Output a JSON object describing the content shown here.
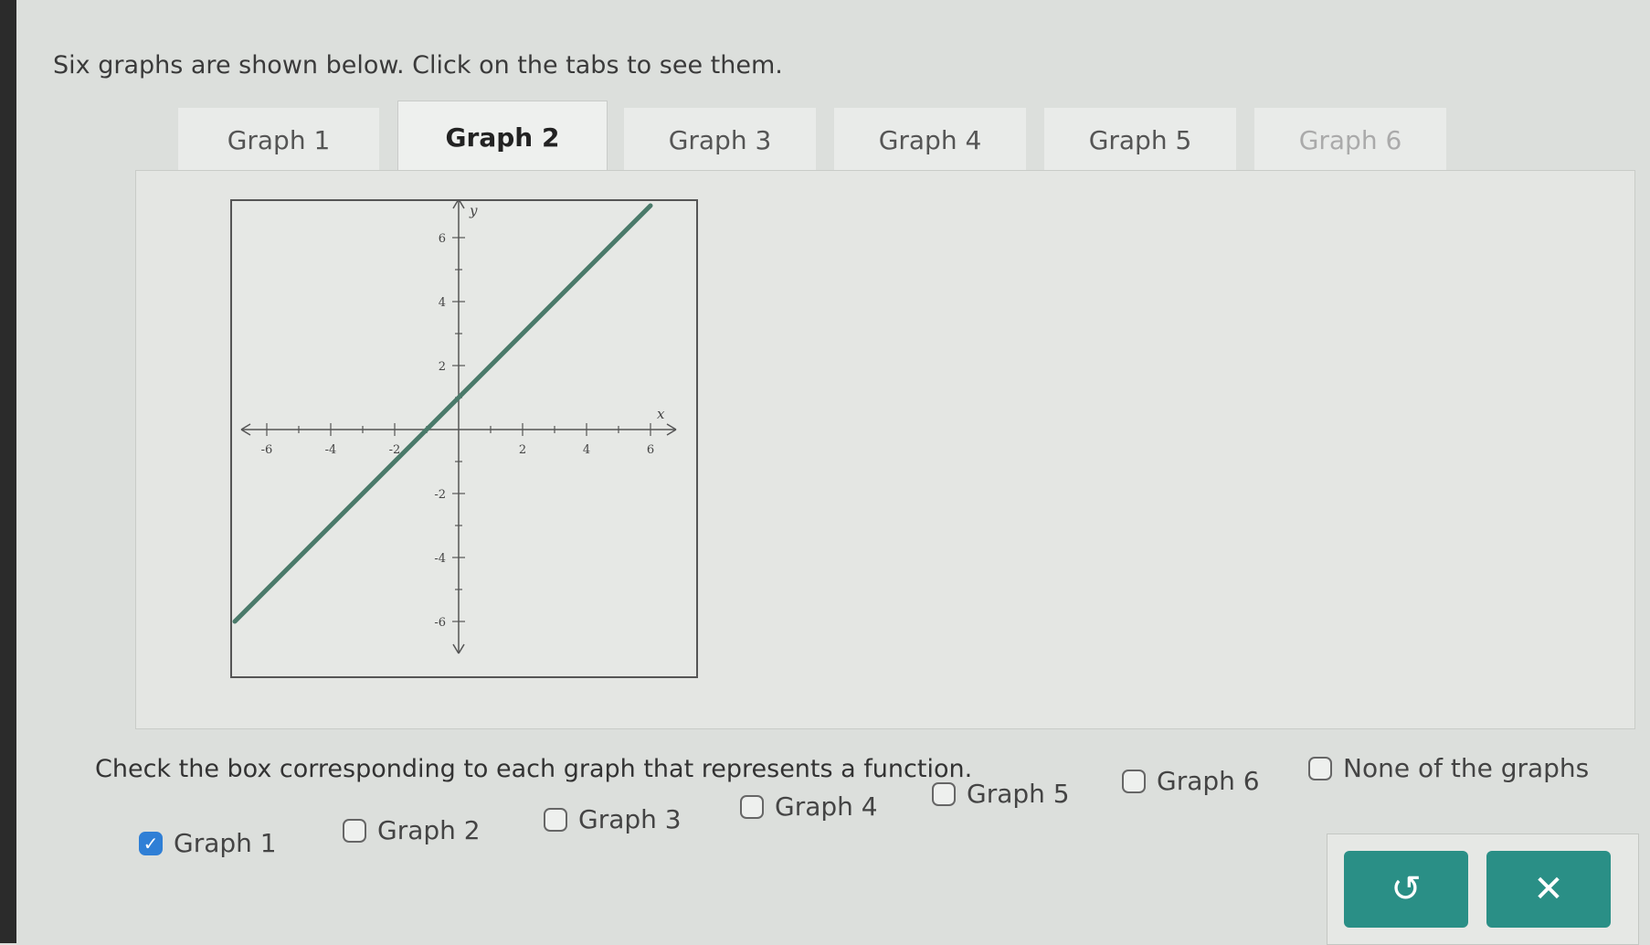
{
  "instruction": "Six graphs are shown below. Click on the tabs to see them.",
  "tabs": [
    {
      "label": "Graph 1",
      "active": false
    },
    {
      "label": "Graph 2",
      "active": true
    },
    {
      "label": "Graph 3",
      "active": false
    },
    {
      "label": "Graph 4",
      "active": false
    },
    {
      "label": "Graph 5",
      "active": false
    },
    {
      "label": "Graph 6",
      "active": false
    }
  ],
  "graph": {
    "x_axis_label": "x",
    "y_axis_label": "y",
    "x_ticks": [
      "-6",
      "-4",
      "-2",
      "2",
      "4",
      "6"
    ],
    "y_ticks": [
      "6",
      "4",
      "2",
      "-2",
      "-4",
      "-6"
    ],
    "line": {
      "from": [
        -7,
        -6
      ],
      "to": [
        6,
        7
      ],
      "color": "#4a7a6a"
    }
  },
  "question": "Check the box corresponding to each graph that represents a function.",
  "options": [
    {
      "label": "Graph 1",
      "checked": true
    },
    {
      "label": "Graph 2",
      "checked": false
    },
    {
      "label": "Graph 3",
      "checked": false
    },
    {
      "label": "Graph 4",
      "checked": false
    },
    {
      "label": "Graph 5",
      "checked": false
    },
    {
      "label": "Graph 6",
      "checked": false
    },
    {
      "label": "None of the graphs",
      "checked": false
    }
  ],
  "buttons": {
    "undo_icon": "undo-icon",
    "clear_icon": "close-icon",
    "undo_glyph": "↺",
    "clear_glyph": "✕"
  },
  "colors": {
    "accent": "#2a8f86",
    "check": "#2f7fd6"
  }
}
